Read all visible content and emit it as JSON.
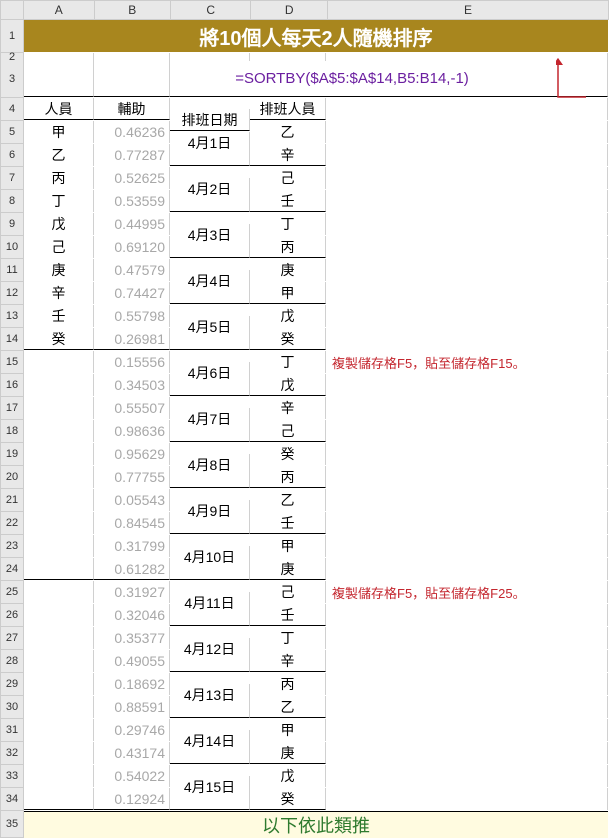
{
  "title": "將10個人每天2人隨機排序",
  "formula": "=SORTBY($A$5:$A$14,B5:B14,-1)",
  "headers": {
    "A": "人員",
    "B": "輔助",
    "C": "排班日期",
    "D": "排班人員"
  },
  "cols": [
    "A",
    "B",
    "C",
    "D",
    "E"
  ],
  "note1": "複製儲存格F5，貼至儲存格F15。",
  "note2": "複製儲存格F5，貼至儲存格F25。",
  "footer": "以下依此類推",
  "personnel": [
    "甲",
    "乙",
    "丙",
    "丁",
    "戊",
    "己",
    "庚",
    "辛",
    "壬",
    "癸"
  ],
  "aux": [
    "0.46236",
    "0.77287",
    "0.52625",
    "0.53559",
    "0.44995",
    "0.69120",
    "0.47579",
    "0.74427",
    "0.55798",
    "0.26981",
    "0.15556",
    "0.34503",
    "0.55507",
    "0.98636",
    "0.95629",
    "0.77755",
    "0.05543",
    "0.84545",
    "0.31799",
    "0.61282",
    "0.31927",
    "0.32046",
    "0.35377",
    "0.49055",
    "0.18692",
    "0.88591",
    "0.29746",
    "0.43174",
    "0.54022",
    "0.12924"
  ],
  "dates": [
    "4月1日",
    "4月2日",
    "4月3日",
    "4月4日",
    "4月5日",
    "4月6日",
    "4月7日",
    "4月8日",
    "4月9日",
    "4月10日",
    "4月11日",
    "4月12日",
    "4月13日",
    "4月14日",
    "4月15日"
  ],
  "assigned": [
    "乙",
    "辛",
    "己",
    "壬",
    "丁",
    "丙",
    "庚",
    "甲",
    "戊",
    "癸",
    "丁",
    "戊",
    "辛",
    "己",
    "癸",
    "丙",
    "乙",
    "壬",
    "甲",
    "庚",
    "己",
    "壬",
    "丁",
    "辛",
    "丙",
    "乙",
    "甲",
    "庚",
    "戊",
    "癸"
  ],
  "chart_data": {
    "type": "table",
    "title": "將10個人每天2人隨機排序",
    "columns": [
      "人員",
      "輔助",
      "排班日期",
      "排班人員"
    ]
  }
}
